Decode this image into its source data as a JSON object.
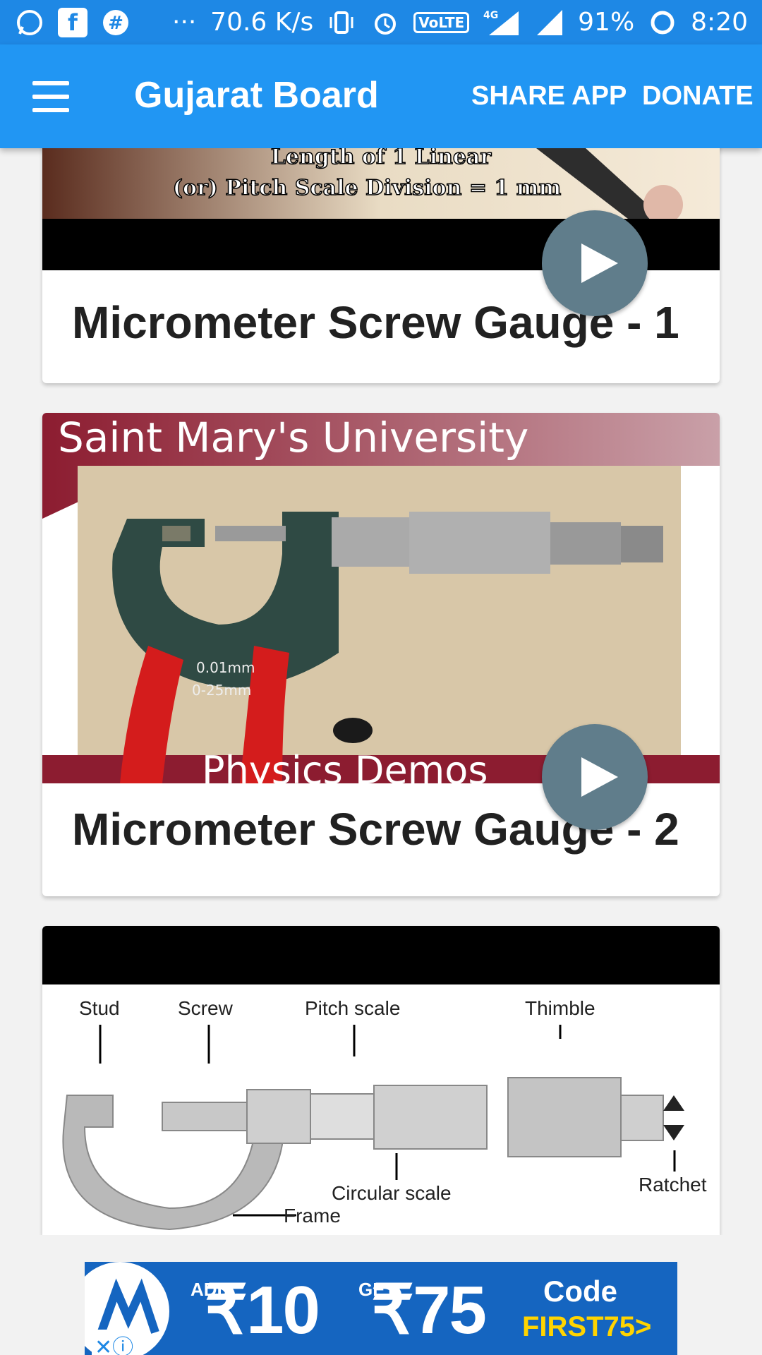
{
  "status_bar": {
    "speed": "70.6 K/s",
    "more": "···",
    "volte": "VoLTE",
    "network": "4G",
    "battery": "91%",
    "time": "8:20"
  },
  "toolbar": {
    "title": "Gujarat Board",
    "share_label": "SHARE APP",
    "donate_label": "DONATE"
  },
  "videos": [
    {
      "title": "Micrometer Screw Gauge - 1",
      "thumb_lines": [
        "Length of 1 Linear",
        "(or) Pitch Scale Division = 1 mm"
      ]
    },
    {
      "title": "Micrometer Screw Gauge - 2",
      "thumb_header": "Saint Mary's University",
      "thumb_footer": "Physics Demos",
      "thumb_marks": [
        "0.01mm",
        "0-25mm"
      ]
    },
    {
      "title": "",
      "diagram_labels": {
        "stud": "Stud",
        "screw": "Screw",
        "pitch": "Pitch scale",
        "thimble": "Thimble",
        "circular": "Circular scale",
        "ratchet": "Ratchet",
        "frame": "Frame"
      }
    }
  ],
  "ad": {
    "add": "ADD",
    "add_amount": "₹10",
    "get": "GET",
    "get_amount": "₹75",
    "code_label": "Code",
    "promo": "FIRST75>"
  },
  "colors": {
    "status_bar": "#1e88e5",
    "toolbar": "#2196f3",
    "play_button": "#607d8b"
  }
}
